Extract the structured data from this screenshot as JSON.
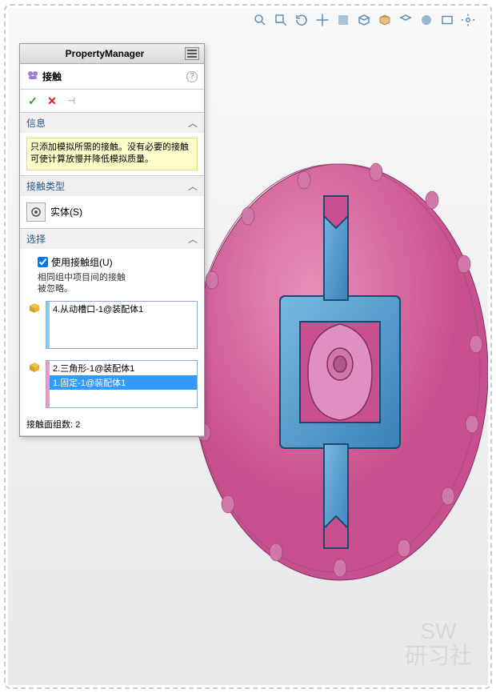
{
  "panel": {
    "title": "PropertyManager",
    "feature_label": "接触",
    "sections": {
      "info": {
        "header": "信息",
        "text": "只添加模拟所需的接触。没有必要的接触可使计算放慢并降低模拟质量。"
      },
      "contact_type": {
        "header": "接触类型",
        "solid_label": "实体(S)"
      },
      "selection": {
        "header": "选择",
        "use_group_label": "使用接触组(U)",
        "use_group_checked": true,
        "sub_text1": "相同组中项目间的接触",
        "sub_text2": "被忽略。",
        "list1": [
          "4.从动槽口-1@装配体1"
        ],
        "list2": [
          "2.三角形-1@装配体1",
          "1.固定-1@装配体1"
        ],
        "list2_selected_index": 1,
        "footer": "接触面组数: 2"
      }
    }
  },
  "watermark": {
    "line1": "SW",
    "line2": "研习社"
  }
}
